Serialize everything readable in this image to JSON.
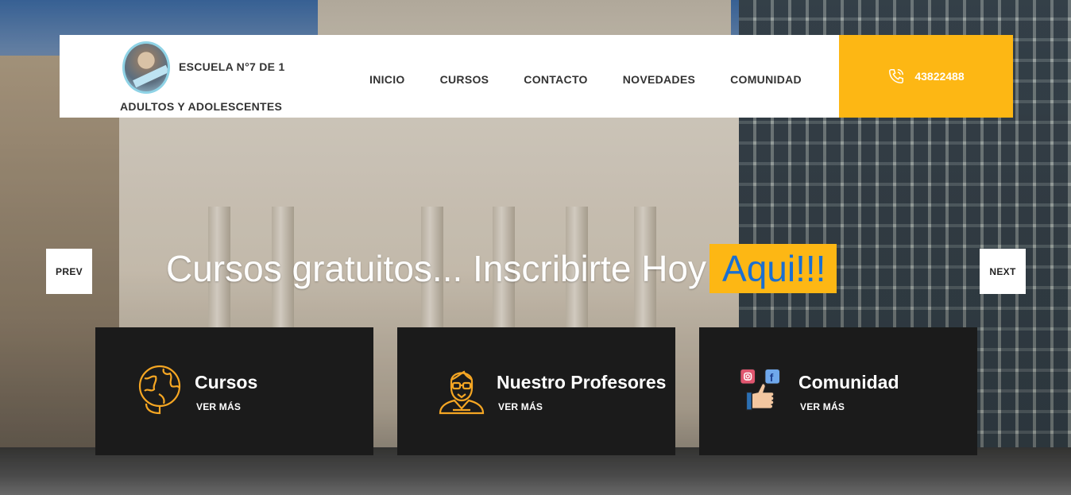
{
  "header": {
    "school_name": "ESCUELA N°7 DE 1",
    "school_subtitle": "ADULTOS Y ADOLESCENTES",
    "nav": [
      {
        "label": "INICIO"
      },
      {
        "label": "CURSOS"
      },
      {
        "label": "CONTACTO"
      },
      {
        "label": "NOVEDADES"
      },
      {
        "label": "COMUNIDAD"
      }
    ],
    "phone": "43822488",
    "phone_icon": "phone-icon",
    "accent_color": "#fdb714"
  },
  "slider": {
    "prev_label": "PREV",
    "next_label": "NEXT",
    "headline": "Cursos gratuitos... Inscribirte Hoy",
    "cta": "Aqui!!!",
    "cta_text_color": "#1a6fd1"
  },
  "cards": [
    {
      "title": "Cursos",
      "more": "VER MÁS",
      "icon": "globe-icon"
    },
    {
      "title": "Nuestro Profesores",
      "more": "VER MÁS",
      "icon": "teacher-icon"
    },
    {
      "title": "Comunidad",
      "more": "VER MÁS",
      "icon": "social-thumbs-up-icon"
    }
  ]
}
